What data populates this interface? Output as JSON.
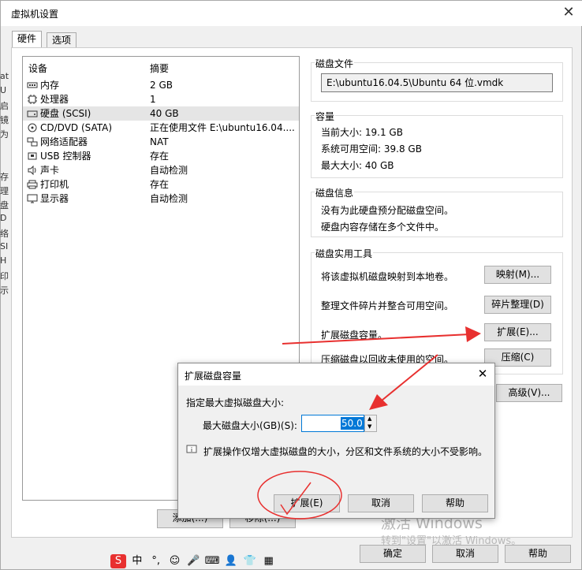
{
  "window": {
    "title": "虚拟机设置",
    "close_glyph": "✕"
  },
  "tabs": [
    {
      "label": "硬件"
    },
    {
      "label": "选项"
    }
  ],
  "left_edge_chars": [
    "at",
    "U",
    "启",
    "镜",
    "为",
    "",
    "",
    "存",
    "理",
    "盘",
    "D",
    "络",
    "SI",
    "H",
    "印",
    "示"
  ],
  "device_list": {
    "col_device": "设备",
    "col_summary": "摘要",
    "rows": [
      {
        "name": "内存",
        "summary": "2 GB",
        "icon": "memory-icon"
      },
      {
        "name": "处理器",
        "summary": "1",
        "icon": "processor-icon"
      },
      {
        "name": "硬盘 (SCSI)",
        "summary": "40 GB",
        "icon": "harddisk-icon"
      },
      {
        "name": "CD/DVD (SATA)",
        "summary": "正在使用文件 E:\\ubuntu16.04....",
        "icon": "cdrom-icon"
      },
      {
        "name": "网络适配器",
        "summary": "NAT",
        "icon": "network-adapter-icon"
      },
      {
        "name": "USB 控制器",
        "summary": "存在",
        "icon": "usb-icon"
      },
      {
        "name": "声卡",
        "summary": "自动检测",
        "icon": "sound-card-icon"
      },
      {
        "name": "打印机",
        "summary": "存在",
        "icon": "printer-icon"
      },
      {
        "name": "显示器",
        "summary": "自动检测",
        "icon": "display-icon"
      }
    ],
    "add_button": "添加(...)",
    "remove_button": "移除(...)"
  },
  "disk_file": {
    "label": "磁盘文件",
    "value": "E:\\ubuntu16.04.5\\Ubuntu 64 位.vmdk"
  },
  "capacity": {
    "label": "容量",
    "current": "当前大小: 19.1 GB",
    "available": "系统可用空间: 39.8 GB",
    "max": "最大大小: 40 GB"
  },
  "disk_info": {
    "label": "磁盘信息",
    "line1": "没有为此硬盘预分配磁盘空间。",
    "line2": "硬盘内容存储在多个文件中。"
  },
  "disk_tools": {
    "label": "磁盘实用工具",
    "map_text": "将该虚拟机磁盘映射到本地卷。",
    "map_btn": "映射(M)...",
    "defrag_text": "整理文件碎片并整合可用空间。",
    "defrag_btn": "碎片整理(D)",
    "expand_text": "扩展磁盘容量。",
    "expand_btn": "扩展(E)...",
    "compact_text": "压缩磁盘以回收未使用的空间。",
    "compact_btn": "压缩(C)"
  },
  "advanced_btn": "高级(V)...",
  "footer": {
    "ok": "确定",
    "cancel": "取消",
    "help": "帮助"
  },
  "dialog": {
    "title": "扩展磁盘容量",
    "close_glyph": "✕",
    "section": "指定最大虚拟磁盘大小:",
    "size_label": "最大磁盘大小(GB)(S):",
    "size_value": "50.0",
    "info": "扩展操作仅增大虚拟磁盘的大小，分区和文件系统的大小不受影响。",
    "expand_btn": "扩展(E)",
    "cancel_btn": "取消",
    "help_btn": "帮助"
  },
  "watermark": {
    "line1": "激活 Windows",
    "line2": "转到\"设置\"以激活 Windows。"
  },
  "annotation_color": "#e8302f"
}
